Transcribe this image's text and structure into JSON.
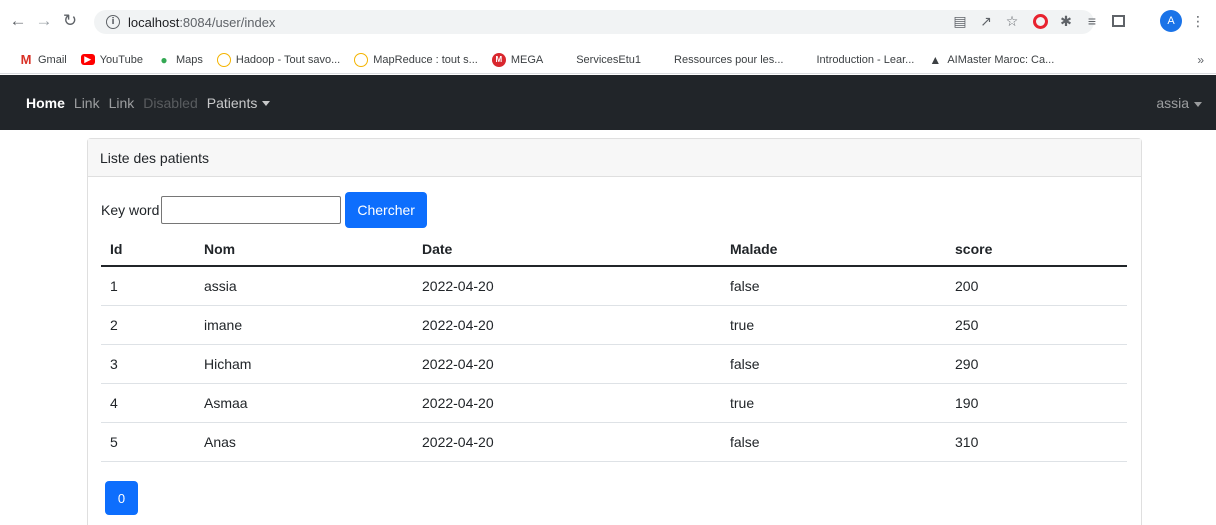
{
  "browser": {
    "url_host": "localhost",
    "url_path": ":8084/user/index",
    "profile_initial": "A",
    "bookmarks": [
      {
        "label": "Gmail",
        "icon": "gmail-icon"
      },
      {
        "label": "YouTube",
        "icon": "youtube-icon"
      },
      {
        "label": "Maps",
        "icon": "maps-icon"
      },
      {
        "label": "Hadoop - Tout savo...",
        "icon": "hadoop-icon"
      },
      {
        "label": "MapReduce : tout s...",
        "icon": "mapreduce-icon"
      },
      {
        "label": "MEGA",
        "icon": "mega-icon"
      },
      {
        "label": "ServicesEtu1",
        "icon": "microsoft-icon"
      },
      {
        "label": "Ressources pour les...",
        "icon": "microsoft-icon"
      },
      {
        "label": "Introduction - Lear...",
        "icon": "microsoft-icon"
      },
      {
        "label": "AIMaster Maroc: Ca...",
        "icon": "graduation-cap-icon"
      }
    ],
    "bookmarks_more": "»"
  },
  "navbar": {
    "home": "Home",
    "link1": "Link",
    "link2": "Link",
    "disabled": "Disabled",
    "patients": "Patients",
    "user": "assia",
    "bg_color": "#212529"
  },
  "card": {
    "header": "Liste des patients",
    "search_label": "Key word",
    "search_value": "",
    "search_button": "Chercher",
    "accent_color": "#0d6efd"
  },
  "table": {
    "headers": [
      "Id",
      "Nom",
      "Date",
      "Malade",
      "score"
    ],
    "rows": [
      [
        "1",
        "assia",
        "2022-04-20",
        "false",
        "200"
      ],
      [
        "2",
        "imane",
        "2022-04-20",
        "true",
        "250"
      ],
      [
        "3",
        "Hicham",
        "2022-04-20",
        "false",
        "290"
      ],
      [
        "4",
        "Asmaa",
        "2022-04-20",
        "true",
        "190"
      ],
      [
        "5",
        "Anas",
        "2022-04-20",
        "false",
        "310"
      ]
    ]
  },
  "pagination": {
    "pages": [
      "0"
    ]
  }
}
